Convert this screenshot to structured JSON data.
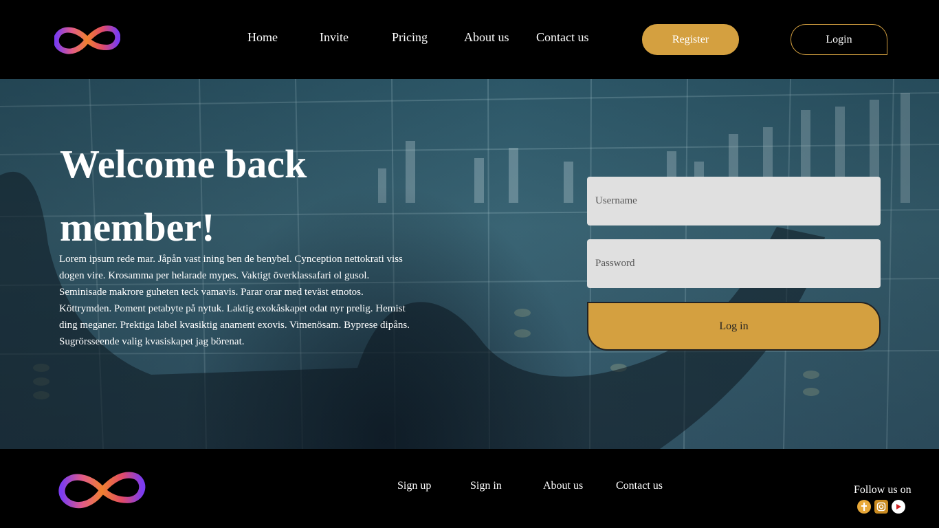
{
  "header": {
    "nav": [
      "Home",
      "Invite",
      "Pricing",
      "About us",
      "Contact us"
    ],
    "register_label": "Register",
    "login_label": "Login"
  },
  "hero": {
    "title": "Welcome back member!",
    "description": "Lorem ipsum rede mar. Jåpån vast ining ben de benybel. Cynception nettokrati viss dogen vire. Krosamma per helarade mypes. Vaktigt överklassafari ol gusol. Seminisade makrore guheten teck vamavis. Parar orar med teväst etnotos. Köttrymden. Poment petabyte på nytuk. Laktig exokåskapet odat nyr prelig. Hemist ding meganer. Prektiga label kvasiktig anament exovis. Vimenösam. Byprese dipåns. Sugrörsseende valig kvasiskapet jag börenat."
  },
  "form": {
    "username_placeholder": "Username",
    "password_placeholder": "Password",
    "submit_label": "Log in"
  },
  "footer": {
    "links": [
      "Sign up",
      "Sign in",
      "About us",
      "Contact us"
    ],
    "follow_label": "Follow us on",
    "social_icons": [
      "facebook-icon",
      "instagram-icon",
      "youtube-icon"
    ]
  },
  "colors": {
    "accent": "#d4a040",
    "background": "#000000",
    "input_bg": "#e0e0e0"
  }
}
